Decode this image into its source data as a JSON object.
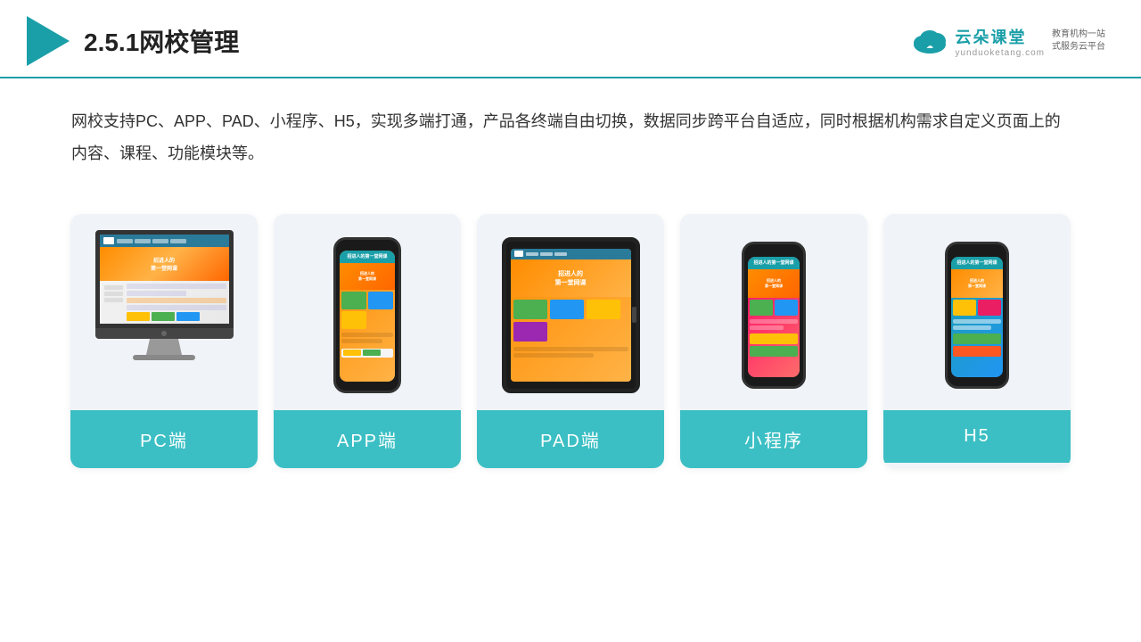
{
  "header": {
    "title": "2.5.1网校管理",
    "brand_name": "云朵课堂",
    "brand_tagline": "教育机构一站\n式服务云平台",
    "brand_url": "yunduoketang.com"
  },
  "description": {
    "text": "网校支持PC、APP、PAD、小程序、H5，实现多端打通，产品各终端自由切换，数据同步跨平台自适应，同时根据机构需求自定义页面上的内容、课程、功能模块等。"
  },
  "cards": [
    {
      "id": "pc",
      "label": "PC端"
    },
    {
      "id": "app",
      "label": "APP端"
    },
    {
      "id": "pad",
      "label": "PAD端"
    },
    {
      "id": "mini-program",
      "label": "小程序"
    },
    {
      "id": "h5",
      "label": "H5"
    }
  ],
  "colors": {
    "teal": "#3bbfc4",
    "dark_teal": "#1a9fa8",
    "bg_card": "#eef2f7",
    "text_main": "#333333"
  }
}
